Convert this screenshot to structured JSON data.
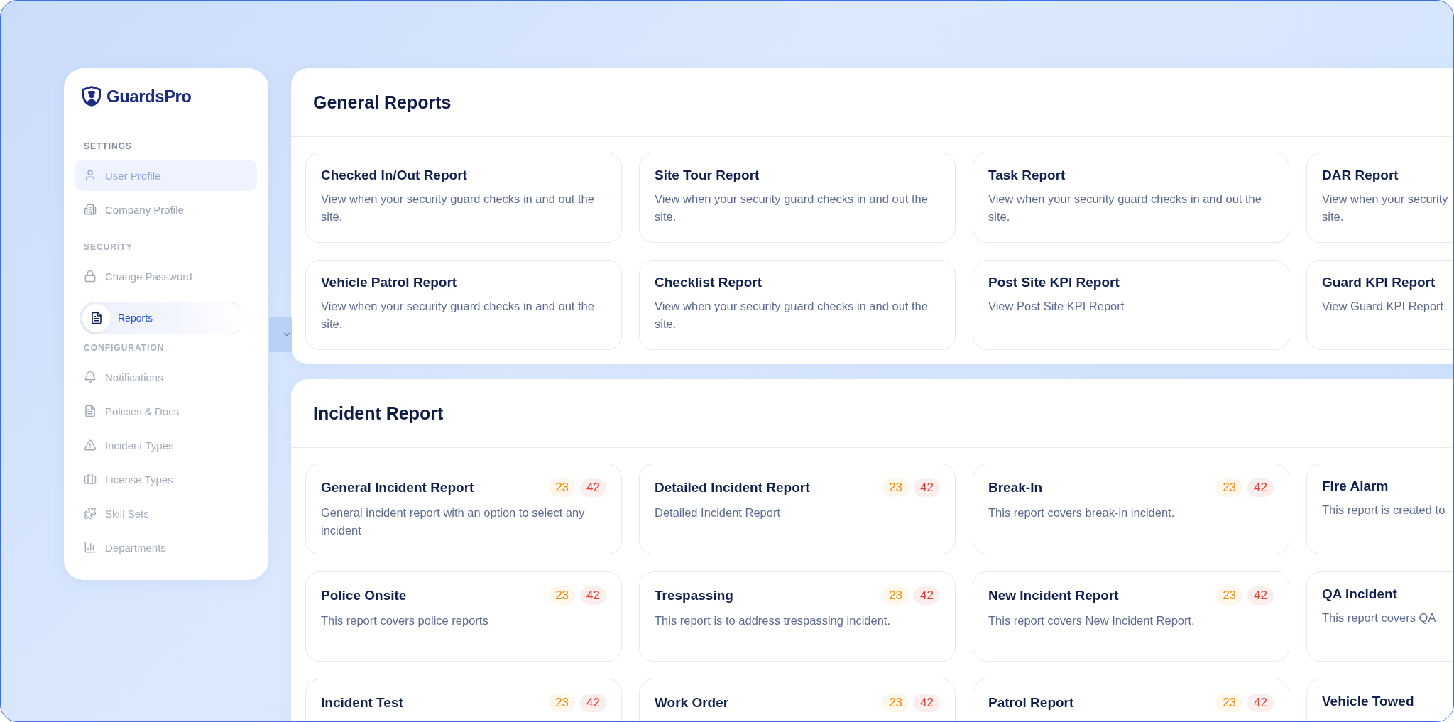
{
  "sidebar": {
    "brand": "GuardsPro",
    "groups": [
      {
        "heading": "SETTINGS",
        "faded": false,
        "items": [
          {
            "label": "User Profile",
            "selected": true
          },
          {
            "label": "Company Profile",
            "selected": false
          }
        ]
      },
      {
        "heading": "SECURITY",
        "faded": true,
        "items": [
          {
            "label": "Change Password",
            "selected": false
          }
        ]
      },
      {
        "heading": "CONFIGURATION",
        "faded": true,
        "items": [
          {
            "label": "Notifications",
            "selected": false
          },
          {
            "label": "Policies & Docs",
            "selected": false
          },
          {
            "label": "Incident Types",
            "selected": false
          },
          {
            "label": "License Types",
            "selected": false
          },
          {
            "label": "Skill Sets",
            "selected": false
          },
          {
            "label": "Departments",
            "selected": false
          }
        ]
      }
    ],
    "floating_item": {
      "label": "Reports"
    }
  },
  "sections": [
    {
      "title": "General Reports",
      "cards": [
        {
          "title": "Checked In/Out Report",
          "description": "View when your security guard checks in and out the site."
        },
        {
          "title": "Site Tour  Report",
          "description": "View when your security guard checks in and out the site."
        },
        {
          "title": "Task Report",
          "description": "View when your security guard checks in and out the site."
        },
        {
          "title": "DAR Report",
          "description": "View when your security\nsite."
        },
        {
          "title": "Vehicle Patrol Report",
          "description": "View when your security guard checks in and out the site."
        },
        {
          "title": "Checklist Report",
          "description": "View when your security guard checks in and out the site."
        },
        {
          "title": "Post Site KPI Report",
          "description": "View Post Site KPI Report"
        },
        {
          "title": "Guard KPI Report",
          "description": "View Guard KPI Report."
        }
      ]
    },
    {
      "title": "Incident Report",
      "cards": [
        {
          "title": "General Incident Report",
          "description": "General incident report with an option to select any incident",
          "counts": [
            {
              "value": "23",
              "kind": "warning"
            },
            {
              "value": "42",
              "kind": "danger"
            }
          ]
        },
        {
          "title": "Detailed Incident Report",
          "description": "Detailed Incident Report",
          "counts": [
            {
              "value": "23",
              "kind": "warning"
            },
            {
              "value": "42",
              "kind": "danger"
            }
          ]
        },
        {
          "title": "Break-In",
          "description": "This report covers break-in incident.",
          "counts": [
            {
              "value": "23",
              "kind": "warning"
            },
            {
              "value": "42",
              "kind": "danger"
            }
          ]
        },
        {
          "title": "Fire Alarm",
          "description": "This report is created to"
        },
        {
          "title": "Police Onsite",
          "description": "This report covers police reports",
          "counts": [
            {
              "value": "23",
              "kind": "warning"
            },
            {
              "value": "42",
              "kind": "danger"
            }
          ]
        },
        {
          "title": "Trespassing",
          "description": "This report is to address trespassing incident.",
          "counts": [
            {
              "value": "23",
              "kind": "warning"
            },
            {
              "value": "42",
              "kind": "danger"
            }
          ]
        },
        {
          "title": "New Incident Report",
          "description": "This report covers New Incident Report.",
          "counts": [
            {
              "value": "23",
              "kind": "warning"
            },
            {
              "value": "42",
              "kind": "danger"
            }
          ]
        },
        {
          "title": "QA Incident",
          "description": "This report covers QA"
        },
        {
          "title": "Incident Test",
          "counts": [
            {
              "value": "23",
              "kind": "warning"
            },
            {
              "value": "42",
              "kind": "danger"
            }
          ]
        },
        {
          "title": "Work Order",
          "counts": [
            {
              "value": "23",
              "kind": "warning"
            },
            {
              "value": "42",
              "kind": "danger"
            }
          ]
        },
        {
          "title": "Patrol Report",
          "counts": [
            {
              "value": "23",
              "kind": "warning"
            },
            {
              "value": "42",
              "kind": "danger"
            }
          ]
        },
        {
          "title": "Vehicle Towed"
        }
      ]
    }
  ]
}
